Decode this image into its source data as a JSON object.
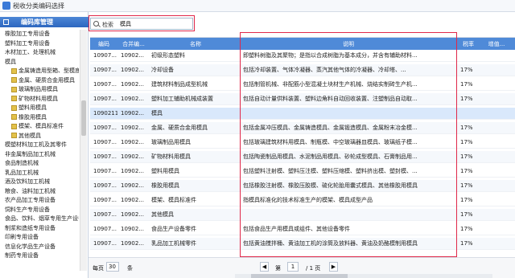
{
  "window": {
    "title": "税收分类编码选择"
  },
  "sidebar": {
    "header": "编码库管理",
    "items": [
      {
        "label": "橡胶加工专用设备",
        "level": 0
      },
      {
        "label": "塑料加工专用设备",
        "level": 0
      },
      {
        "label": "木材加工、处理机械",
        "level": 0
      },
      {
        "label": "模具",
        "level": 0
      },
      {
        "label": "金属铸造用型箱、型模底",
        "level": 1
      },
      {
        "label": "金属、硬质合金用模具",
        "level": 1
      },
      {
        "label": "玻璃制品用模具",
        "level": 1
      },
      {
        "label": "矿物材料用模具",
        "level": 1
      },
      {
        "label": "塑料用模具",
        "level": 1
      },
      {
        "label": "橡胶用模具",
        "level": 1
      },
      {
        "label": "模架、模具标准件",
        "level": 1
      },
      {
        "label": "其他模具",
        "level": 1
      },
      {
        "label": "模塑材料加工机及其零件",
        "level": 0
      },
      {
        "label": "非金属制品加工机械",
        "level": 0
      },
      {
        "label": "食品制造机械",
        "level": 0
      },
      {
        "label": "乳品加工机械",
        "level": 0
      },
      {
        "label": "酒及饮料加工机械",
        "level": 0
      },
      {
        "label": "粮食、油料加工机械",
        "level": 0
      },
      {
        "label": "农产品加工专用设备",
        "level": 0
      },
      {
        "label": "饲料生产专用设备",
        "level": 0
      },
      {
        "label": "食品、饮料、烟草专用生产设备",
        "level": 0
      },
      {
        "label": "制浆和造纸专用设备",
        "level": 0
      },
      {
        "label": "印刷专用设备",
        "level": 0
      },
      {
        "label": "信息化学品生产设备",
        "level": 0
      },
      {
        "label": "制药专用设备",
        "level": 0
      }
    ]
  },
  "search": {
    "label": "检索",
    "value": "模具"
  },
  "table": {
    "columns": [
      "编码",
      "合并编...",
      "名称",
      "说明",
      "税率",
      "增值..."
    ],
    "rows": [
      {
        "code": "10907...",
        "merged": "10902...",
        "name": "初级形态塑料",
        "desc": "即塑料树脂及其聚物；是指以合成树脂为基本成分，并含有辅助材料...",
        "rate": "",
        "vat": ""
      },
      {
        "code": "10907...",
        "merged": "10902...",
        "name": "冷却设备",
        "desc": "包括冷却装置、气体冷凝器、蒸汽其他气体的冷凝器、冷却塔、...",
        "rate": "17%",
        "vat": ""
      },
      {
        "code": "10907...",
        "merged": "10902...",
        "name": "建筑材料制品成型机械",
        "desc": "包括制管机械、非配筋小型混凝土块材生产机械、烧结实制砖生产机...",
        "rate": "17%",
        "vat": ""
      },
      {
        "code": "10907...",
        "merged": "10902...",
        "name": "塑料加工辅助机械成装置",
        "desc": "包括自动计量供料装置、塑料边角料自动回收装置、注塑制品自动取...",
        "rate": "17%",
        "vat": ""
      },
      {
        "code": "1090211",
        "merged": "10902...",
        "name": "模具",
        "desc": "",
        "rate": "",
        "vat": ""
      },
      {
        "code": "10907...",
        "merged": "10902...",
        "name": "金属、硬质合金用模具",
        "desc": "包括金属冲压模具、金属铸造模具、金属锻造模具、金属粉末冶金模...",
        "rate": "17%",
        "vat": ""
      },
      {
        "code": "10907...",
        "merged": "10902...",
        "name": "玻璃制品用模具",
        "desc": "包括玻璃建筑材料用模具、制瓶模、中空玻璃器皿模具、玻璃纸子模...",
        "rate": "17%",
        "vat": ""
      },
      {
        "code": "10907...",
        "merged": "10902...",
        "name": "矿物材料用模具",
        "desc": "包括陶瓷制品用模具、水泥制品用模具、砂轮成型模具、石膏制品用...",
        "rate": "17%",
        "vat": ""
      },
      {
        "code": "10907...",
        "merged": "10902...",
        "name": "塑料用模具",
        "desc": "包括塑料注射模、塑料压注模、塑料压缩模、塑料挤出模、塑封模、...",
        "rate": "17%",
        "vat": ""
      },
      {
        "code": "10907...",
        "merged": "10902...",
        "name": "橡胶用模具",
        "desc": "包括橡胶注射模、橡胶压胶模、硫化轮胎用囊式模具、其他橡胶用模具",
        "rate": "17%",
        "vat": ""
      },
      {
        "code": "10907...",
        "merged": "10902...",
        "name": "模架、模具标准件",
        "desc": "指模具标准化的技术标准生产的模架、模具成型产品",
        "rate": "17%",
        "vat": ""
      },
      {
        "code": "10907...",
        "merged": "10902...",
        "name": "其他模具",
        "desc": "",
        "rate": "17%",
        "vat": ""
      },
      {
        "code": "10907...",
        "merged": "10902...",
        "name": "食品生产设备零件",
        "desc": "包括食品生产用模具或组件、其他设备零件",
        "rate": "17%",
        "vat": ""
      },
      {
        "code": "10907...",
        "merged": "10902...",
        "name": "乳品加工机械零件",
        "desc": "包括黄油搅拌桶、黄油加工机的涂筒及放料器、黄油及奶酪模制用模具",
        "rate": "17%",
        "vat": ""
      }
    ]
  },
  "pagination": {
    "per_page_label": "每页",
    "per_page_value": "30",
    "per_page_unit": "条",
    "prev_icon": "◀",
    "page_label_pre": "第",
    "current_page": "1",
    "total_label": "/ 1  页",
    "next_icon": "▶"
  },
  "colors": {
    "header_blue": "#4f8ad8",
    "highlight_red": "#e0284a"
  }
}
